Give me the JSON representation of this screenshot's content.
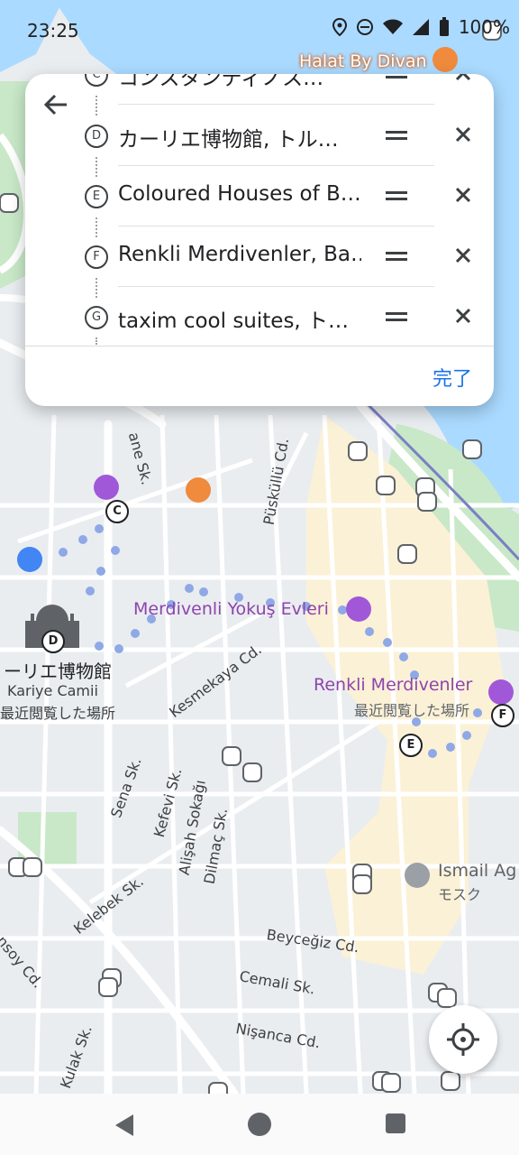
{
  "status_bar": {
    "time": "23:25",
    "battery": "100%"
  },
  "stops": [
    {
      "letter": "C",
      "label": "コンスタンティノス…"
    },
    {
      "letter": "D",
      "label": "カーリエ博物館, トル…"
    },
    {
      "letter": "E",
      "label": "Coloured Houses of B…"
    },
    {
      "letter": "F",
      "label": "Renkli Merdivenler, Ba…"
    },
    {
      "letter": "G",
      "label": "taxim cool suites, ト…"
    }
  ],
  "done_label": "完了",
  "map": {
    "pois": [
      {
        "name": "Halat By Divan",
        "color": "#ffffff"
      },
      {
        "name": "Merdivenli Yokuş Evleri",
        "color": "#8e44ad"
      },
      {
        "name": "Renkli Merdivenler",
        "color": "#8e44ad"
      },
      {
        "name": "最近閲覧した場所",
        "color": "#5f6368"
      },
      {
        "name": "ーリエ博物館",
        "color": "#202124"
      },
      {
        "name": "Kariye Camii",
        "color": "#3c4043"
      },
      {
        "name": "最近閲覧した場所",
        "color": "#3c4043"
      },
      {
        "name": "Ismail Ag",
        "color": "#5f6368"
      },
      {
        "name": "モスク",
        "color": "#5f6368"
      }
    ],
    "streets": [
      "Kesmekaya Cd.",
      "Püsküllü Cd.",
      "Sena Sk.",
      "Kefevi Sk.",
      "Alişah Sokağı",
      "Dilmaç Sk.",
      "Kelebek Sk.",
      "Beyceğiz Cd.",
      "Cemali Sk.",
      "Nişanca Cd.",
      "Kulak Sk.",
      "nsoy Cd.",
      "ane Sk."
    ],
    "waypoints": [
      "C",
      "D",
      "E",
      "F"
    ]
  }
}
